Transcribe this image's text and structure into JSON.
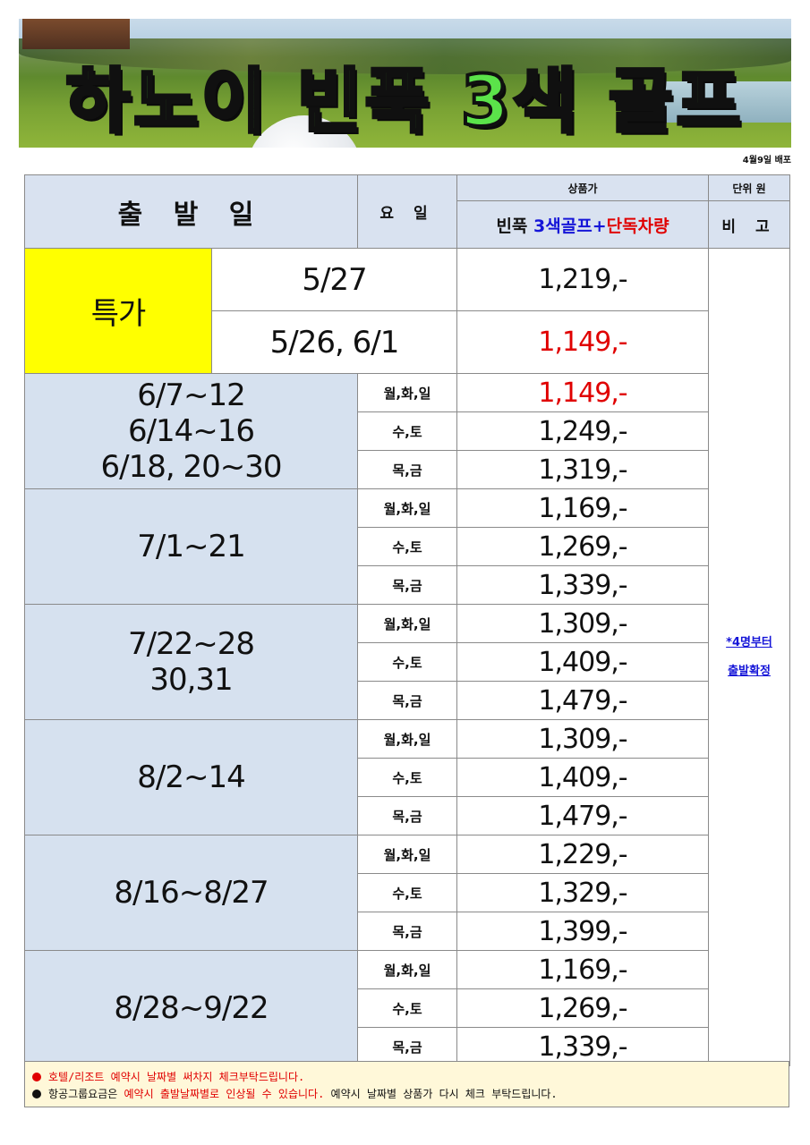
{
  "banner": {
    "title": "하노이 빈푹 3색 골프"
  },
  "release_note": "4월9일 배포",
  "table": {
    "header": {
      "departure": "출 발 일",
      "weekday": "요 일",
      "price_label": "상품가",
      "unit": "단위 원",
      "product_prefix": "빈푹",
      "product_blue": "3색골프+",
      "product_red": "단독차량",
      "remarks": "비 고"
    },
    "special": {
      "label": "특가",
      "rows": [
        {
          "date": "5/27",
          "price": "1,219,-",
          "highlight": false
        },
        {
          "date": "5/26,  6/1",
          "price": "1,149,-",
          "highlight": true
        }
      ]
    },
    "groups": [
      {
        "dates": [
          "6/7~12",
          "6/14~16",
          "6/18,  20~30"
        ],
        "rows": [
          {
            "day": "월,화,일",
            "price": "1,149,-",
            "highlight": true
          },
          {
            "day": "수,토",
            "price": "1,249,-",
            "highlight": false
          },
          {
            "day": "목,금",
            "price": "1,319,-",
            "highlight": false
          }
        ]
      },
      {
        "dates": [
          "7/1~21"
        ],
        "rows": [
          {
            "day": "월,화,일",
            "price": "1,169,-",
            "highlight": false
          },
          {
            "day": "수,토",
            "price": "1,269,-",
            "highlight": false
          },
          {
            "day": "목,금",
            "price": "1,339,-",
            "highlight": false
          }
        ]
      },
      {
        "dates": [
          "7/22~28",
          "30,31"
        ],
        "rows": [
          {
            "day": "월,화,일",
            "price": "1,309,-",
            "highlight": false
          },
          {
            "day": "수,토",
            "price": "1,409,-",
            "highlight": false
          },
          {
            "day": "목,금",
            "price": "1,479,-",
            "highlight": false
          }
        ]
      },
      {
        "dates": [
          "8/2~14"
        ],
        "rows": [
          {
            "day": "월,화,일",
            "price": "1,309,-",
            "highlight": false
          },
          {
            "day": "수,토",
            "price": "1,409,-",
            "highlight": false
          },
          {
            "day": "목,금",
            "price": "1,479,-",
            "highlight": false
          }
        ]
      },
      {
        "dates": [
          "8/16~8/27"
        ],
        "rows": [
          {
            "day": "월,화,일",
            "price": "1,229,-",
            "highlight": false
          },
          {
            "day": "수,토",
            "price": "1,329,-",
            "highlight": false
          },
          {
            "day": "목,금",
            "price": "1,399,-",
            "highlight": false
          }
        ]
      },
      {
        "dates": [
          "8/28~9/22"
        ],
        "rows": [
          {
            "day": "월,화,일",
            "price": "1,169,-",
            "highlight": false
          },
          {
            "day": "수,토",
            "price": "1,269,-",
            "highlight": false
          },
          {
            "day": "목,금",
            "price": "1,339,-",
            "highlight": false
          }
        ]
      }
    ],
    "remarks_note": [
      "*4명부터",
      "출발확정"
    ]
  },
  "footer": {
    "line1": "호텔/리조트 예약시 날짜별 써차지 체크부탁드립니다.",
    "line2_start": "항공그룹요금은 ",
    "line2_red": "예약시 출발날짜별로 인상될 수 있습니다.",
    "line2_end": " 예약시 날짜별 상품가 다시 체크 부탁드립니다."
  },
  "colors": {
    "accent_red": "#e00000",
    "accent_blue": "#1515d8",
    "highlight_yellow": "#ffff00",
    "cell_blue": "#d6e1ef"
  }
}
